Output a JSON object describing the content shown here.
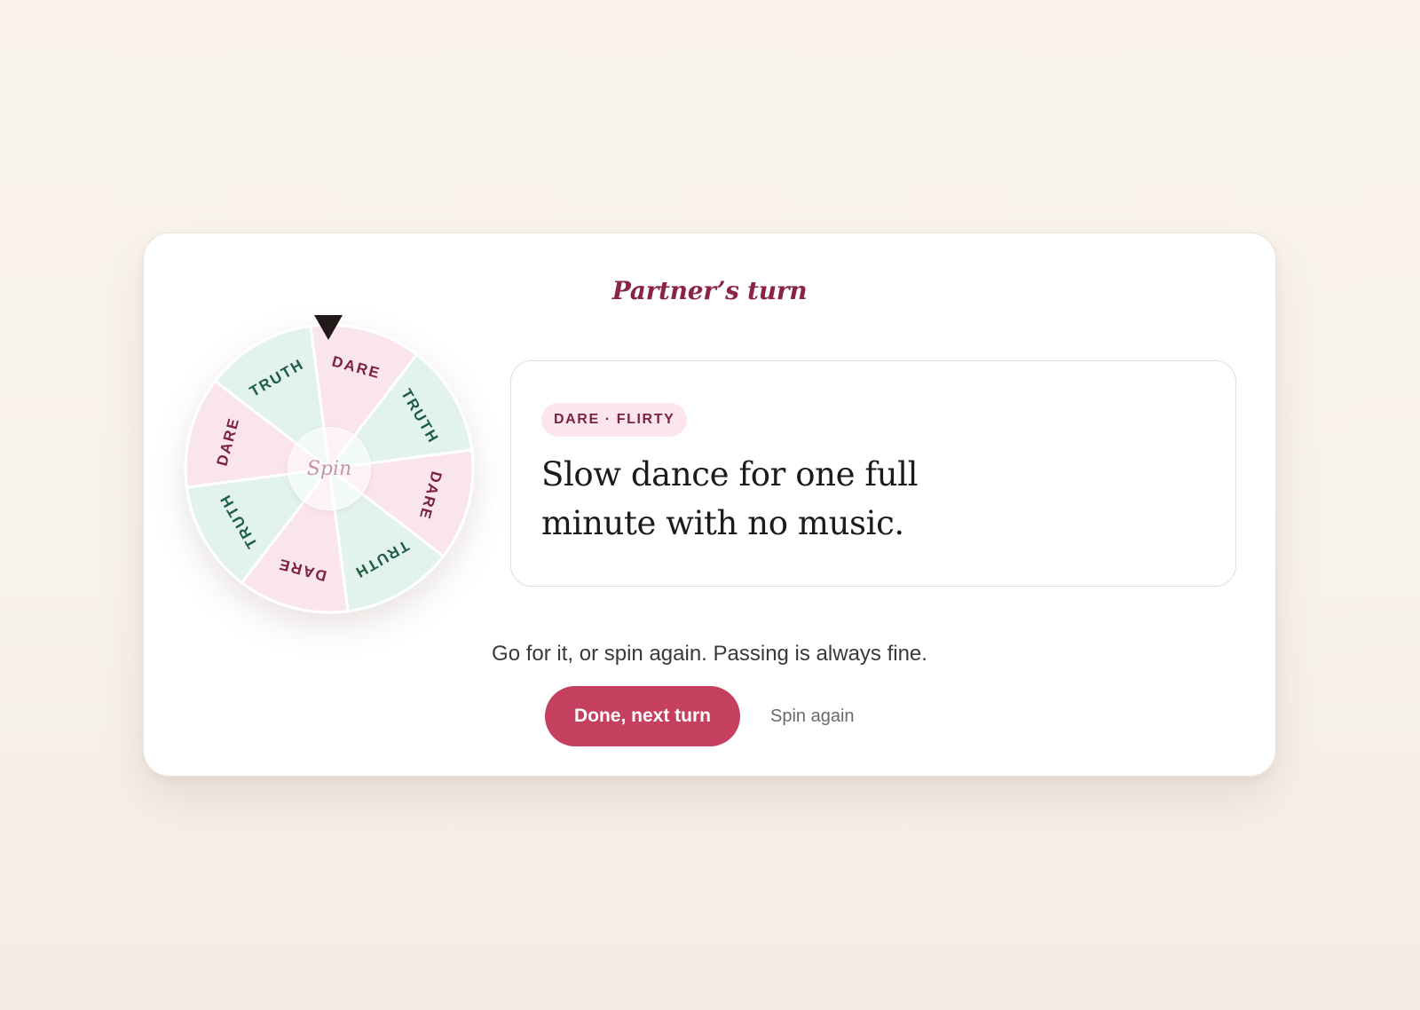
{
  "game": {
    "turn_title": "Partner’s turn",
    "wheel": {
      "segments": [
        {
          "label": "DARE",
          "type": "dare"
        },
        {
          "label": "TRUTH",
          "type": "truth"
        },
        {
          "label": "DARE",
          "type": "dare"
        },
        {
          "label": "TRUTH",
          "type": "truth"
        },
        {
          "label": "DARE",
          "type": "dare"
        },
        {
          "label": "TRUTH",
          "type": "truth"
        },
        {
          "label": "DARE",
          "type": "dare"
        },
        {
          "label": "TRUTH",
          "type": "truth"
        }
      ],
      "hub_label": "Spin",
      "pointer_icon": "triangle-down-icon"
    },
    "prompt": {
      "badge": "DARE · FLIRTY",
      "text": "Slow dance for one full minute with no music."
    },
    "hint": "Go for it, or spin again. Passing is always fine.",
    "actions": {
      "done_label": "Done, next turn",
      "spin_again_label": "Spin again"
    }
  },
  "colors": {
    "dare_fill": "#fbe5ec",
    "truth_fill": "#e2f3ec",
    "dare_text": "#7a2240",
    "truth_text": "#1f5c44",
    "accent": "#c5405f",
    "title": "#8a2446"
  }
}
